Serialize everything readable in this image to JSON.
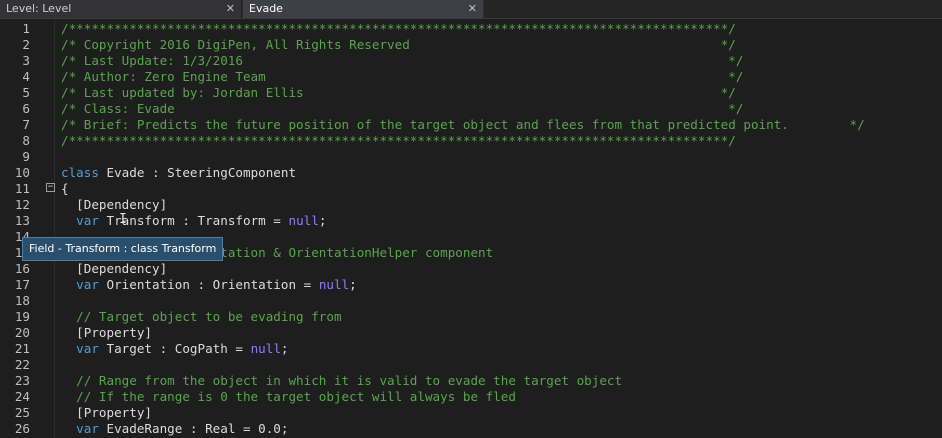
{
  "tabs": [
    {
      "label": "Level: Level",
      "close": "✕"
    },
    {
      "label": "Evade",
      "close": "✕"
    }
  ],
  "tooltip": "Field - Transform : class Transform",
  "fold_glyph": "−",
  "lines": [
    {
      "n": "1",
      "parts": [
        {
          "c": "comment",
          "t": "/***************************************************************************************/"
        }
      ]
    },
    {
      "n": "2",
      "parts": [
        {
          "c": "comment",
          "t": "/* Copyright 2016 DigiPen, All Rights Reserved                                         */"
        }
      ]
    },
    {
      "n": "3",
      "parts": [
        {
          "c": "comment",
          "t": "/* Last Update: 1/3/2016                                                                */"
        }
      ]
    },
    {
      "n": "4",
      "parts": [
        {
          "c": "comment",
          "t": "/* Author: Zero Engine Team                                                             */"
        }
      ]
    },
    {
      "n": "5",
      "parts": [
        {
          "c": "comment",
          "t": "/* Last updated by: Jordan Ellis                                                       */"
        }
      ]
    },
    {
      "n": "6",
      "parts": [
        {
          "c": "comment",
          "t": "/* Class: Evade                                                                         */"
        }
      ]
    },
    {
      "n": "7",
      "parts": [
        {
          "c": "comment",
          "t": "/* Brief: Predicts the future position of the target object and flees from that predicted point.        */"
        }
      ]
    },
    {
      "n": "8",
      "parts": [
        {
          "c": "comment",
          "t": "/***************************************************************************************/"
        }
      ]
    },
    {
      "n": "9",
      "parts": []
    },
    {
      "n": "10",
      "parts": [
        {
          "c": "kw",
          "t": "class"
        },
        {
          "c": "plain",
          "t": " Evade : SteeringComponent"
        }
      ]
    },
    {
      "n": "11",
      "parts": [
        {
          "c": "plain",
          "t": "{"
        }
      ]
    },
    {
      "n": "12",
      "parts": [
        {
          "c": "ws",
          "t": "  "
        },
        {
          "c": "plain",
          "t": "[Dependency]"
        }
      ]
    },
    {
      "n": "13",
      "parts": [
        {
          "c": "ws",
          "t": "  "
        },
        {
          "c": "kw",
          "t": "var"
        },
        {
          "c": "plain",
          "t": " Transform : Transform = "
        },
        {
          "c": "nullkw",
          "t": "null"
        },
        {
          "c": "plain",
          "t": ";"
        }
      ]
    },
    {
      "n": "14",
      "parts": [
        {
          "c": "ws",
          "t": "  "
        }
      ]
    },
    {
      "n": "15",
      "parts": [
        {
          "c": "ws",
          "t": "  "
        },
        {
          "c": "comment",
          "t": "// Depends on Orientation & OrientationHelper component"
        }
      ]
    },
    {
      "n": "16",
      "parts": [
        {
          "c": "ws",
          "t": "  "
        },
        {
          "c": "plain",
          "t": "[Dependency]"
        }
      ]
    },
    {
      "n": "17",
      "parts": [
        {
          "c": "ws",
          "t": "  "
        },
        {
          "c": "kw",
          "t": "var"
        },
        {
          "c": "plain",
          "t": " Orientation : Orientation = "
        },
        {
          "c": "nullkw",
          "t": "null"
        },
        {
          "c": "plain",
          "t": ";"
        }
      ]
    },
    {
      "n": "18",
      "parts": [
        {
          "c": "ws",
          "t": "  "
        }
      ]
    },
    {
      "n": "19",
      "parts": [
        {
          "c": "ws",
          "t": "  "
        },
        {
          "c": "comment",
          "t": "// Target object to be evading from"
        }
      ]
    },
    {
      "n": "20",
      "parts": [
        {
          "c": "ws",
          "t": "  "
        },
        {
          "c": "plain",
          "t": "[Property]"
        }
      ]
    },
    {
      "n": "21",
      "parts": [
        {
          "c": "ws",
          "t": "  "
        },
        {
          "c": "kw",
          "t": "var"
        },
        {
          "c": "plain",
          "t": " Target : CogPath = "
        },
        {
          "c": "nullkw",
          "t": "null"
        },
        {
          "c": "plain",
          "t": ";"
        }
      ]
    },
    {
      "n": "22",
      "parts": [
        {
          "c": "ws",
          "t": "  "
        }
      ]
    },
    {
      "n": "23",
      "parts": [
        {
          "c": "ws",
          "t": "  "
        },
        {
          "c": "comment",
          "t": "// Range from the object in which it is valid to evade the target object"
        }
      ]
    },
    {
      "n": "24",
      "parts": [
        {
          "c": "ws",
          "t": "  "
        },
        {
          "c": "comment",
          "t": "// If the range is 0 the target object will always be fled"
        }
      ]
    },
    {
      "n": "25",
      "parts": [
        {
          "c": "ws",
          "t": "  "
        },
        {
          "c": "plain",
          "t": "[Property]"
        }
      ]
    },
    {
      "n": "26",
      "parts": [
        {
          "c": "ws",
          "t": "  "
        },
        {
          "c": "kw",
          "t": "var"
        },
        {
          "c": "plain",
          "t": " EvadeRange : Real = 0.0;"
        }
      ]
    }
  ]
}
